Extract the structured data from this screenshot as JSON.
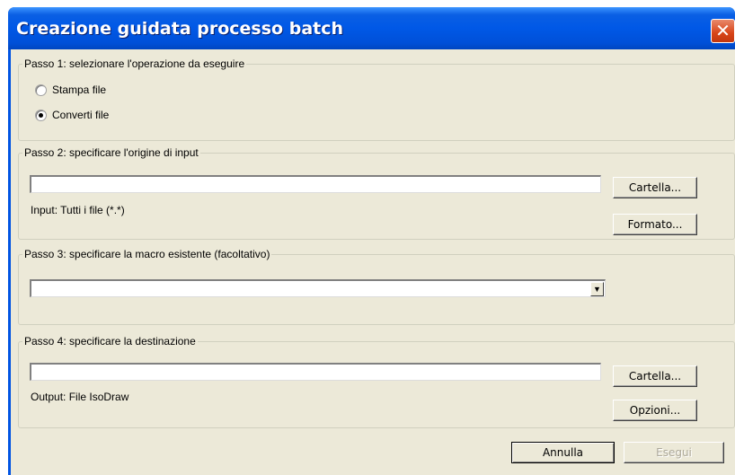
{
  "window": {
    "title": "Creazione guidata processo batch",
    "close_symbol": "✕"
  },
  "step1": {
    "legend": "Passo 1: selezionare l'operazione da eseguire",
    "options": [
      {
        "label": "Stampa file",
        "checked": false
      },
      {
        "label": "Converti file",
        "checked": true
      }
    ]
  },
  "step2": {
    "legend": "Passo 2: specificare l'origine di input",
    "input_value": "",
    "folder_button": "Cartella...",
    "format_button": "Formato...",
    "info": "Input: Tutti i file (*.*)"
  },
  "step3": {
    "legend": "Passo 3: specificare la macro esistente (facoltativo)",
    "selected_value": "",
    "arrow_symbol": "▼"
  },
  "step4": {
    "legend": "Passo 4: specificare la destinazione",
    "input_value": "",
    "folder_button": "Cartella...",
    "options_button": "Opzioni...",
    "info": "Output: File IsoDraw"
  },
  "footer": {
    "cancel_button": "Annulla",
    "run_button": "Esegui"
  }
}
